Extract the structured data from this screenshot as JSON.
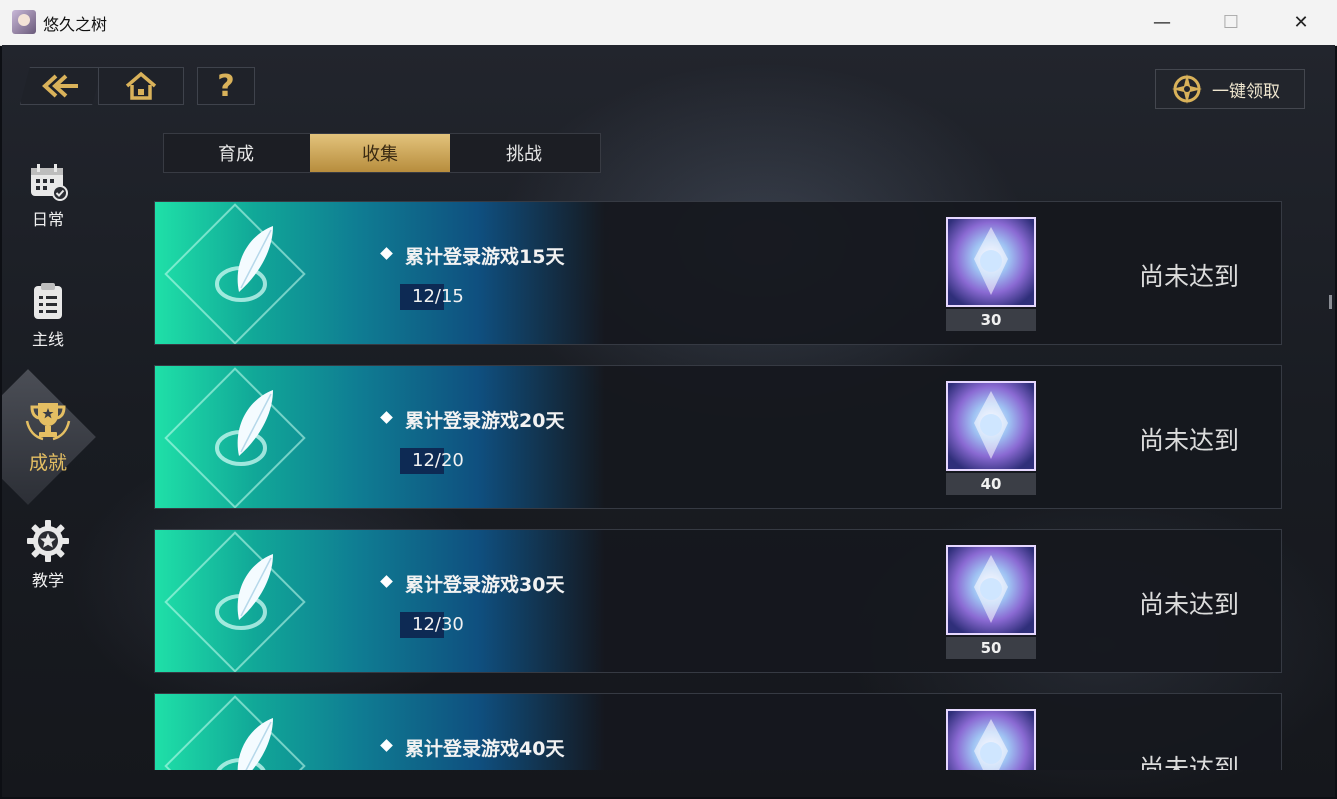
{
  "window": {
    "title": "悠久之树",
    "controls": [
      "—",
      "☐",
      "✕"
    ]
  },
  "topbar": {
    "back_icon": "back-arrow-icon",
    "home_icon": "home-icon",
    "help_label": "?",
    "claim_all_label": "一键领取",
    "claim_icon": "compass-star-icon"
  },
  "sidebar": {
    "items": [
      {
        "label": "日常",
        "icon": "calendar-check-icon",
        "active": false
      },
      {
        "label": "主线",
        "icon": "clipboard-list-icon",
        "active": false
      },
      {
        "label": "成就",
        "icon": "trophy-icon",
        "active": true
      },
      {
        "label": "教学",
        "icon": "star-gear-icon",
        "active": false
      }
    ]
  },
  "tabs": [
    {
      "label": "育成",
      "active": false
    },
    {
      "label": "收集",
      "active": true
    },
    {
      "label": "挑战",
      "active": false
    }
  ],
  "achievements": [
    {
      "title": "累计登录游戏15天",
      "progress": "12/15",
      "reward_count": "30",
      "status": "尚未达到"
    },
    {
      "title": "累计登录游戏20天",
      "progress": "12/20",
      "reward_count": "40",
      "status": "尚未达到"
    },
    {
      "title": "累计登录游戏30天",
      "progress": "12/30",
      "reward_count": "50",
      "status": "尚未达到"
    },
    {
      "title": "累计登录游戏40天",
      "progress": "",
      "reward_count": "",
      "status": "尚未达到"
    }
  ],
  "colors": {
    "accent_gold": "#d9b25a",
    "tab_active": "#c9a04e",
    "art_teal": "#1fe0a8",
    "art_blue": "#0f4f7f"
  }
}
